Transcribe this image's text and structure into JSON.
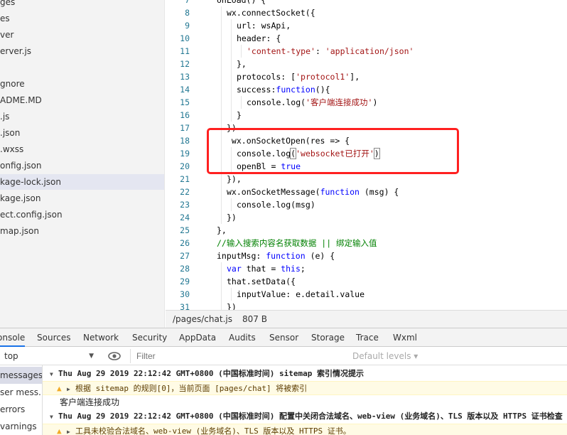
{
  "file_tree": {
    "items": [
      {
        "label": "ges",
        "active": false
      },
      {
        "label": "es",
        "active": false
      },
      {
        "label": "ver",
        "active": false
      },
      {
        "label": "erver.js",
        "active": false
      },
      {
        "label": "",
        "active": false
      },
      {
        "label": "gnore",
        "active": false
      },
      {
        "label": "ADME.MD",
        "active": false
      },
      {
        "label": ".js",
        "active": false
      },
      {
        "label": ".json",
        "active": false
      },
      {
        "label": ".wxss",
        "active": false
      },
      {
        "label": "onfig.json",
        "active": false
      },
      {
        "label": "kage-lock.json",
        "active": true
      },
      {
        "label": "kage.json",
        "active": false
      },
      {
        "label": "ect.config.json",
        "active": false
      },
      {
        "label": "map.json",
        "active": false
      }
    ]
  },
  "editor": {
    "lines": [
      {
        "num": "7",
        "indent": 0,
        "tokens": [
          {
            "t": "onLoad() {",
            "c": ""
          }
        ]
      },
      {
        "num": "8",
        "indent": 1,
        "tokens": [
          {
            "t": "wx.connectSocket({",
            "c": ""
          }
        ]
      },
      {
        "num": "9",
        "indent": 2,
        "tokens": [
          {
            "t": "url: wsApi,",
            "c": ""
          }
        ]
      },
      {
        "num": "10",
        "indent": 2,
        "tokens": [
          {
            "t": "header: {",
            "c": ""
          }
        ]
      },
      {
        "num": "11",
        "indent": 3,
        "tokens": [
          {
            "t": "'content-type'",
            "c": "t-str"
          },
          {
            "t": ": ",
            "c": ""
          },
          {
            "t": "'application/json'",
            "c": "t-str"
          }
        ]
      },
      {
        "num": "12",
        "indent": 2,
        "tokens": [
          {
            "t": "},",
            "c": ""
          }
        ]
      },
      {
        "num": "13",
        "indent": 2,
        "tokens": [
          {
            "t": "protocols: [",
            "c": ""
          },
          {
            "t": "'protocol1'",
            "c": "t-str"
          },
          {
            "t": "],",
            "c": ""
          }
        ]
      },
      {
        "num": "14",
        "indent": 2,
        "tokens": [
          {
            "t": "success:",
            "c": ""
          },
          {
            "t": "function",
            "c": "t-kw"
          },
          {
            "t": "(){",
            "c": ""
          }
        ]
      },
      {
        "num": "15",
        "indent": 3,
        "tokens": [
          {
            "t": "console.log(",
            "c": ""
          },
          {
            "t": "'客户端连接成功'",
            "c": "t-str"
          },
          {
            "t": ")",
            "c": ""
          }
        ]
      },
      {
        "num": "16",
        "indent": 2,
        "tokens": [
          {
            "t": "}",
            "c": ""
          }
        ]
      },
      {
        "num": "17",
        "indent": 1,
        "tokens": [
          {
            "t": "})",
            "c": ""
          }
        ]
      },
      {
        "num": "18",
        "indent": 1,
        "tokens": [
          {
            "t": " wx.onSocketOpen(res => {",
            "c": ""
          }
        ]
      },
      {
        "num": "19",
        "indent": 2,
        "tokens": [
          {
            "t": "console.log",
            "c": ""
          },
          {
            "t": "(",
            "c": "cursor-box"
          },
          {
            "t": "'websocket已打开'",
            "c": "t-str"
          },
          {
            "t": ")",
            "c": "cursor-box"
          }
        ]
      },
      {
        "num": "20",
        "indent": 2,
        "tokens": [
          {
            "t": "openBl = ",
            "c": ""
          },
          {
            "t": "true",
            "c": "t-kw"
          }
        ]
      },
      {
        "num": "21",
        "indent": 1,
        "tokens": [
          {
            "t": "}),",
            "c": ""
          }
        ]
      },
      {
        "num": "22",
        "indent": 1,
        "tokens": [
          {
            "t": "wx.onSocketMessage(",
            "c": ""
          },
          {
            "t": "function",
            "c": "t-kw"
          },
          {
            "t": " (msg) {",
            "c": ""
          }
        ]
      },
      {
        "num": "23",
        "indent": 2,
        "tokens": [
          {
            "t": "console.log(msg)",
            "c": ""
          }
        ]
      },
      {
        "num": "24",
        "indent": 1,
        "tokens": [
          {
            "t": "})",
            "c": ""
          }
        ]
      },
      {
        "num": "25",
        "indent": 0,
        "tokens": [
          {
            "t": "},",
            "c": ""
          }
        ]
      },
      {
        "num": "26",
        "indent": 0,
        "tokens": [
          {
            "t": "//输入搜索内容名获取数据 || 绑定输入值",
            "c": "t-cm"
          }
        ]
      },
      {
        "num": "27",
        "indent": 0,
        "tokens": [
          {
            "t": "inputMsg: ",
            "c": ""
          },
          {
            "t": "function",
            "c": "t-kw"
          },
          {
            "t": " (e) {",
            "c": ""
          }
        ]
      },
      {
        "num": "28",
        "indent": 1,
        "tokens": [
          {
            "t": "var",
            "c": "t-kw"
          },
          {
            "t": " that = ",
            "c": ""
          },
          {
            "t": "this",
            "c": "t-kw"
          },
          {
            "t": ";",
            "c": ""
          }
        ]
      },
      {
        "num": "29",
        "indent": 1,
        "tokens": [
          {
            "t": "that.setData({",
            "c": ""
          }
        ]
      },
      {
        "num": "30",
        "indent": 2,
        "tokens": [
          {
            "t": "inputValue: e.detail.value",
            "c": ""
          }
        ]
      },
      {
        "num": "31",
        "indent": 1,
        "tokens": [
          {
            "t": "})",
            "c": ""
          }
        ]
      }
    ]
  },
  "status_bar": {
    "path": "/pages/chat.js",
    "size": "807 B"
  },
  "devtools": {
    "tabs": [
      {
        "label": "onsole",
        "active": true
      },
      {
        "label": "Sources",
        "active": false
      },
      {
        "label": "Network",
        "active": false
      },
      {
        "label": "Security",
        "active": false
      },
      {
        "label": "AppData",
        "active": false
      },
      {
        "label": "Audits",
        "active": false
      },
      {
        "label": "Sensor",
        "active": false
      },
      {
        "label": "Storage",
        "active": false
      },
      {
        "label": "Trace",
        "active": false
      },
      {
        "label": "Wxml",
        "active": false
      }
    ],
    "context": "top",
    "filter_placeholder": "Filter",
    "levels": "Default levels ▾",
    "sidebar": [
      {
        "label": "messages",
        "active": true
      },
      {
        "label": "ser mess...",
        "active": false
      },
      {
        "label": "errors",
        "active": false
      },
      {
        "label": "varnings",
        "active": false
      }
    ],
    "log": [
      {
        "type": "group",
        "text": "Thu Aug 29 2019 22:12:42 GMT+0800 (中国标准时间) sitemap 索引情况提示"
      },
      {
        "type": "warn",
        "text": "根据 sitemap 的规则[0]，当前页面 [pages/chat] 将被索引"
      },
      {
        "type": "plain",
        "text": "客户端连接成功"
      },
      {
        "type": "group",
        "text": "Thu Aug 29 2019 22:12:42 GMT+0800 (中国标准时间) 配置中关闭合法域名、web-view (业务域名)、TLS 版本以及 HTTPS 证书检查"
      },
      {
        "type": "warn",
        "text": "工具未校验合法域名、web-view (业务域名)、TLS 版本以及 HTTPS 证书。"
      }
    ]
  },
  "colors": {
    "highlight_box": "#ff2020",
    "accent": "#1a73e8",
    "warning": "#f2ab26"
  }
}
